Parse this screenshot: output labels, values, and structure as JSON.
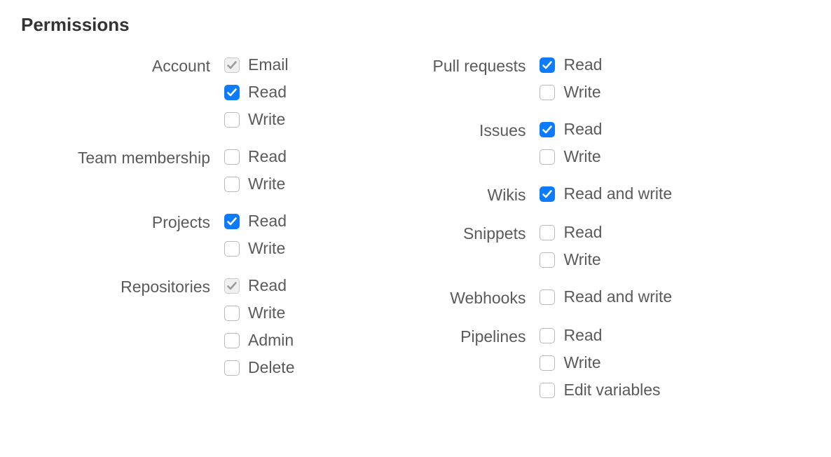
{
  "title": "Permissions",
  "columns": [
    {
      "groups": [
        {
          "label": "Account",
          "options": [
            {
              "label": "Email",
              "state": "disabled-checked"
            },
            {
              "label": "Read",
              "state": "checked"
            },
            {
              "label": "Write",
              "state": "unchecked"
            }
          ]
        },
        {
          "label": "Team membership",
          "options": [
            {
              "label": "Read",
              "state": "unchecked"
            },
            {
              "label": "Write",
              "state": "unchecked"
            }
          ]
        },
        {
          "label": "Projects",
          "options": [
            {
              "label": "Read",
              "state": "checked"
            },
            {
              "label": "Write",
              "state": "unchecked"
            }
          ]
        },
        {
          "label": "Repositories",
          "options": [
            {
              "label": "Read",
              "state": "disabled-checked"
            },
            {
              "label": "Write",
              "state": "unchecked"
            },
            {
              "label": "Admin",
              "state": "unchecked"
            },
            {
              "label": "Delete",
              "state": "unchecked"
            }
          ]
        }
      ]
    },
    {
      "groups": [
        {
          "label": "Pull requests",
          "options": [
            {
              "label": "Read",
              "state": "checked"
            },
            {
              "label": "Write",
              "state": "unchecked"
            }
          ]
        },
        {
          "label": "Issues",
          "options": [
            {
              "label": "Read",
              "state": "checked"
            },
            {
              "label": "Write",
              "state": "unchecked"
            }
          ]
        },
        {
          "label": "Wikis",
          "options": [
            {
              "label": "Read and write",
              "state": "checked"
            }
          ]
        },
        {
          "label": "Snippets",
          "options": [
            {
              "label": "Read",
              "state": "unchecked"
            },
            {
              "label": "Write",
              "state": "unchecked"
            }
          ]
        },
        {
          "label": "Webhooks",
          "options": [
            {
              "label": "Read and write",
              "state": "unchecked"
            }
          ]
        },
        {
          "label": "Pipelines",
          "options": [
            {
              "label": "Read",
              "state": "unchecked"
            },
            {
              "label": "Write",
              "state": "unchecked"
            },
            {
              "label": "Edit variables",
              "state": "unchecked"
            }
          ]
        }
      ]
    }
  ]
}
